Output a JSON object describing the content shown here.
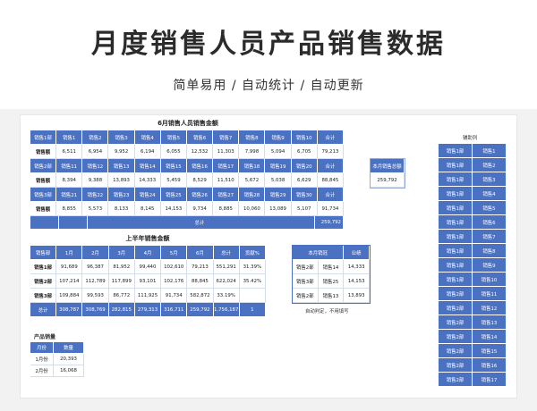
{
  "header": {
    "title": "月度销售人员产品销售数据",
    "subtitle": "简单易用 / 自动统计 / 自动更新"
  },
  "table1": {
    "title": "6月销售人员销售金额",
    "rows": [
      [
        "销售1部",
        "销售1",
        "销售2",
        "销售3",
        "销售4",
        "销售5",
        "销售6",
        "销售7",
        "销售8",
        "销售9",
        "销售10",
        "合计"
      ],
      [
        "销售额",
        "6,511",
        "6,954",
        "9,952",
        "6,194",
        "6,055",
        "12,532",
        "11,303",
        "7,998",
        "5,094",
        "6,705",
        "79,213"
      ],
      [
        "销售2部",
        "销售11",
        "销售12",
        "销售13",
        "销售14",
        "销售15",
        "销售16",
        "销售17",
        "销售18",
        "销售19",
        "销售20",
        "合计"
      ],
      [
        "销售额",
        "8,394",
        "9,388",
        "13,893",
        "14,333",
        "5,459",
        "8,529",
        "11,510",
        "5,672",
        "5,038",
        "6,629",
        "88,845"
      ],
      [
        "销售3部",
        "销售21",
        "销售22",
        "销售23",
        "销售24",
        "销售25",
        "销售26",
        "销售27",
        "销售28",
        "销售29",
        "销售30",
        "合计"
      ],
      [
        "销售额",
        "8,855",
        "5,573",
        "8,133",
        "8,145",
        "14,153",
        "9,734",
        "8,885",
        "10,060",
        "13,089",
        "5,107",
        "91,734"
      ]
    ],
    "total_label": "总计",
    "total_value": "259,792"
  },
  "month_box": {
    "label": "本月销售总额",
    "value": "259,792"
  },
  "table2": {
    "title": "上半年销售金额",
    "header": [
      "销售部",
      "1月",
      "2月",
      "3月",
      "4月",
      "5月",
      "6月",
      "总计",
      "贡献%"
    ],
    "rows": [
      [
        "销售1部",
        "91,689",
        "96,387",
        "81,952",
        "99,440",
        "102,610",
        "79,213",
        "551,291",
        "31.39%"
      ],
      [
        "销售2部",
        "107,214",
        "112,789",
        "117,899",
        "93,101",
        "102,176",
        "88,845",
        "622,024",
        "35.42%"
      ],
      [
        "销售3部",
        "109,884",
        "99,593",
        "86,772",
        "111,925",
        "91,734",
        "582,872",
        "33.19%"
      ]
    ],
    "row3_full": [
      "销售3部",
      "109,884",
      "99,593",
      "86,772",
      "111,925",
      "91,734",
      "582,872",
      "33.19%"
    ],
    "total_row": [
      "总计",
      "308,787",
      "308,769",
      "282,815",
      "279,313",
      "316,711",
      "259,792",
      "1,756,187",
      "1"
    ]
  },
  "table2_row3": [
    "销售3部",
    "109,884",
    "99,593",
    "86,772",
    "111,925",
    "91,734",
    "582,872",
    "33.19%"
  ],
  "champion": {
    "header": [
      "本月销冠",
      "业绩"
    ],
    "rows": [
      [
        "销售2部",
        "销售14",
        "14,333"
      ],
      [
        "销售3部",
        "销售25",
        "14,153"
      ],
      [
        "销售2部",
        "销售13",
        "13,893"
      ]
    ],
    "note": "自动判定，不用填写"
  },
  "product": {
    "title": "产品销量",
    "header": [
      "月份",
      "数量"
    ],
    "rows": [
      [
        "1月份",
        "20,393"
      ],
      [
        "2月份",
        "16,068"
      ]
    ]
  },
  "aux": {
    "title": "辅助列",
    "items": [
      "销售1部",
      "销售1部",
      "销售1部",
      "销售1部",
      "销售1部",
      "销售1部",
      "销售1部",
      "销售1部",
      "销售1部",
      "销售1部",
      "销售1部",
      "销售1部",
      "销售1部",
      "销售1部",
      "销售1部",
      "销售2部",
      "销售2部",
      "销售2部",
      "销售2部",
      "销售2部",
      "销售2部",
      "销售2部",
      "销售2部",
      "销售2部",
      "销售2部",
      "销售2部",
      "销售2部",
      "销售2部",
      "销售2部",
      "销售2部",
      "销售2部",
      "销售2部",
      "销售2部"
    ],
    "labels": [
      "销售1",
      "销售2",
      "销售3",
      "销售4",
      "销售5",
      "销售6",
      "销售7",
      "销售8",
      "销售9",
      "销售10",
      "销售11",
      "销售12",
      "销售13",
      "销售14",
      "销售15",
      "销售16",
      "销售17"
    ],
    "groups": [
      "销售1部",
      "销售1部",
      "销售1部",
      "销售1部",
      "销售1部",
      "销售1部",
      "销售1部",
      "销售1部",
      "销售1部",
      "销售1部",
      "销售2部",
      "销售2部",
      "销售2部",
      "销售2部",
      "销售2部",
      "销售2部",
      "销售2部"
    ]
  }
}
